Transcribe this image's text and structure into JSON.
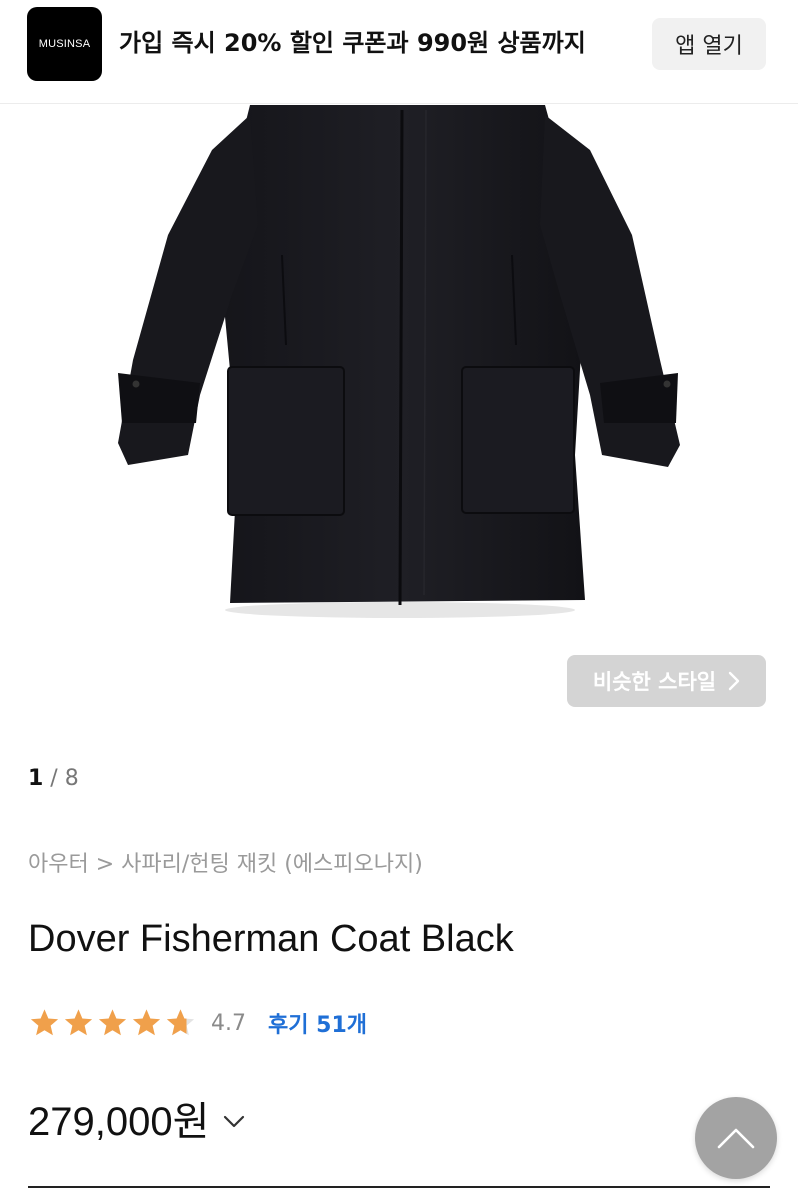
{
  "banner": {
    "logo_text": "MUSINSA",
    "promo_text": "가입 즉시 20% 할인 쿠폰과 990원 상품까지",
    "open_app_label": "앱 열기"
  },
  "gallery": {
    "similar_style_label": "비슷한 스타일",
    "current_page": "1",
    "separator": " / ",
    "total_pages": "8"
  },
  "product": {
    "breadcrumb": "아우터 > 사파리/헌팅 재킷 (에스피오나지)",
    "name": "Dover Fisherman Coat Black",
    "rating": "4.7",
    "rating_stars": 4.7,
    "reviews_label": "후기 51개",
    "price": "279,000원"
  },
  "colors": {
    "star": "#F0A04B",
    "review_link": "#1F6FD6",
    "similar_button": "#D4D4D4",
    "scroll_top_button": "#A3A3A3"
  },
  "icons": {
    "similar_arrow": "chevron-right-icon",
    "price_toggle": "chevron-down-icon",
    "scroll_top": "chevron-up-icon"
  }
}
